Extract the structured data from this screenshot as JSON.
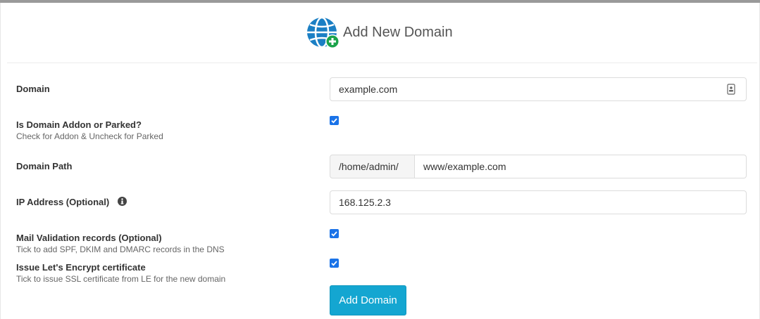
{
  "header": {
    "title": "Add New Domain",
    "icon": "globe-plus-icon"
  },
  "form": {
    "domain": {
      "label": "Domain",
      "value": "example.com",
      "icon": "contact-card-icon"
    },
    "addon_or_parked": {
      "label": "Is Domain Addon or Parked?",
      "help": "Check for Addon & Uncheck for Parked",
      "checked": true
    },
    "domain_path": {
      "label": "Domain Path",
      "prefix": "/home/admin/",
      "value": "www/example.com"
    },
    "ip_address": {
      "label": "IP Address (Optional)",
      "value": "168.125.2.3",
      "icon": "info-icon"
    },
    "mail_validation": {
      "label": "Mail Validation records (Optional)",
      "help": "Tick to add SPF, DKIM and DMARC records in the DNS",
      "checked": true
    },
    "lets_encrypt": {
      "label": "Issue Let's Encrypt certificate",
      "help": "Tick to issue SSL certificate from LE for the new domain",
      "checked": true
    },
    "submit_label": "Add Domain"
  },
  "colors": {
    "accent": "#14a6d1",
    "checkbox": "#1a73e8",
    "globe": "#1b7fc4",
    "plus": "#1aa34a"
  }
}
